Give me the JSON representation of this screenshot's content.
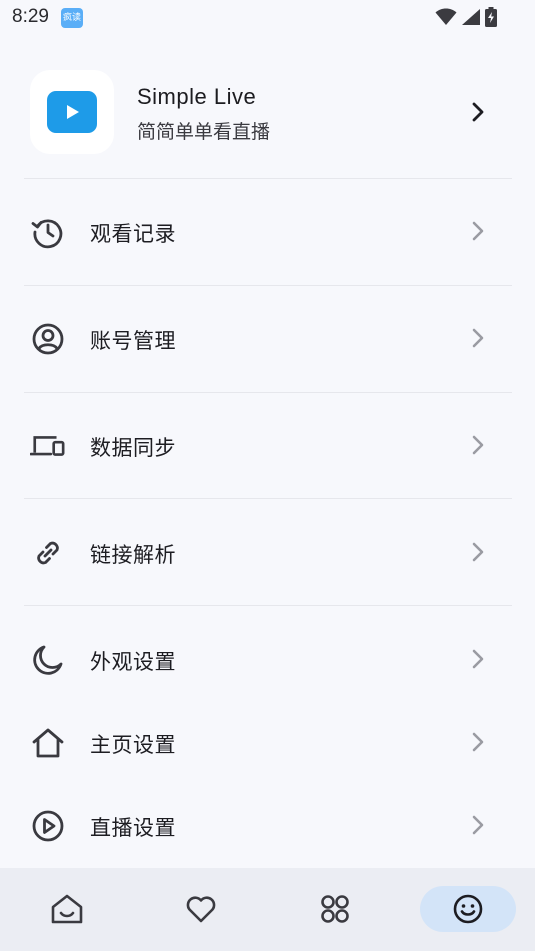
{
  "status_bar": {
    "time": "8:29",
    "app_badge": "疯读",
    "icons": [
      "wifi-icon",
      "signal-icon",
      "battery-charging-icon"
    ]
  },
  "app_header": {
    "name": "Simple Live",
    "subtitle": "简简单单看直播",
    "logo_icon": "play-logo-icon",
    "accent_color": "#1e9be8"
  },
  "menu": {
    "items": [
      {
        "label": "观看记录",
        "icon": "history-icon"
      },
      {
        "label": "账号管理",
        "icon": "account-circle-icon"
      },
      {
        "label": "数据同步",
        "icon": "devices-icon"
      },
      {
        "label": "链接解析",
        "icon": "link-icon"
      },
      {
        "label": "外观设置",
        "icon": "moon-icon"
      },
      {
        "label": "主页设置",
        "icon": "home-icon"
      },
      {
        "label": "直播设置",
        "icon": "play-circle-icon"
      }
    ]
  },
  "bottom_nav": {
    "items": [
      {
        "icon": "home-icon",
        "active": false
      },
      {
        "icon": "heart-icon",
        "active": false
      },
      {
        "icon": "categories-icon",
        "active": false
      },
      {
        "icon": "smile-icon",
        "active": true
      }
    ],
    "active_color": "#d3e4f8"
  }
}
